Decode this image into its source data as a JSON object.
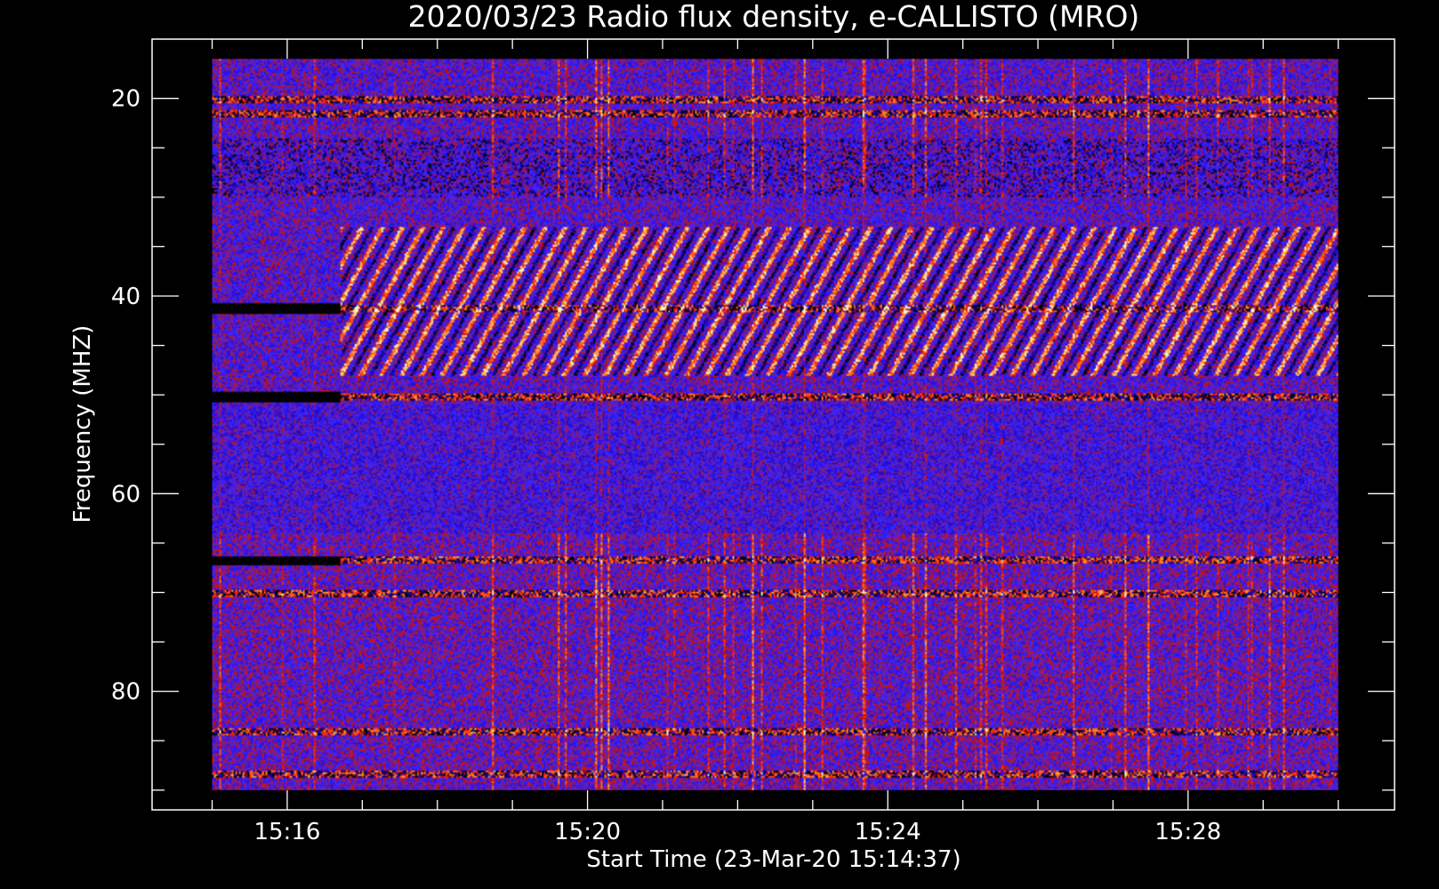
{
  "chart_data": {
    "type": "heatmap",
    "title": "2020/03/23  Radio flux density, e-CALLISTO (MRO)",
    "xlabel": "Start Time (23-Mar-20 15:14:37)",
    "ylabel": "Frequency (MHZ)",
    "x_tick_labels": [
      "15:16",
      "15:20",
      "15:24",
      "15:28"
    ],
    "x_tick_minutes": [
      16,
      20,
      24,
      28
    ],
    "y_tick_labels": [
      "20",
      "40",
      "60",
      "80"
    ],
    "y_tick_values": [
      20,
      40,
      60,
      80
    ],
    "x_range_minutes": [
      14.2,
      30.75
    ],
    "data_range_minutes": [
      15.0,
      30.0
    ],
    "y_range_mhz": [
      14.0,
      92.0
    ],
    "data_range_mhz": [
      16.0,
      90.0
    ],
    "y_inverted": true,
    "colormap": [
      "#000000",
      "#1a0090",
      "#2a10e0",
      "#3a28ff",
      "#c01010",
      "#ff3010",
      "#ff8a20",
      "#ffffc0"
    ],
    "constant_bands_mhz": [
      20.0,
      21.5,
      41.2,
      50.2,
      66.8,
      70.2,
      84.2,
      88.5
    ],
    "burst_region_mhz": [
      33,
      48
    ],
    "burst_active_minutes": [
      16.7,
      30.0
    ]
  }
}
